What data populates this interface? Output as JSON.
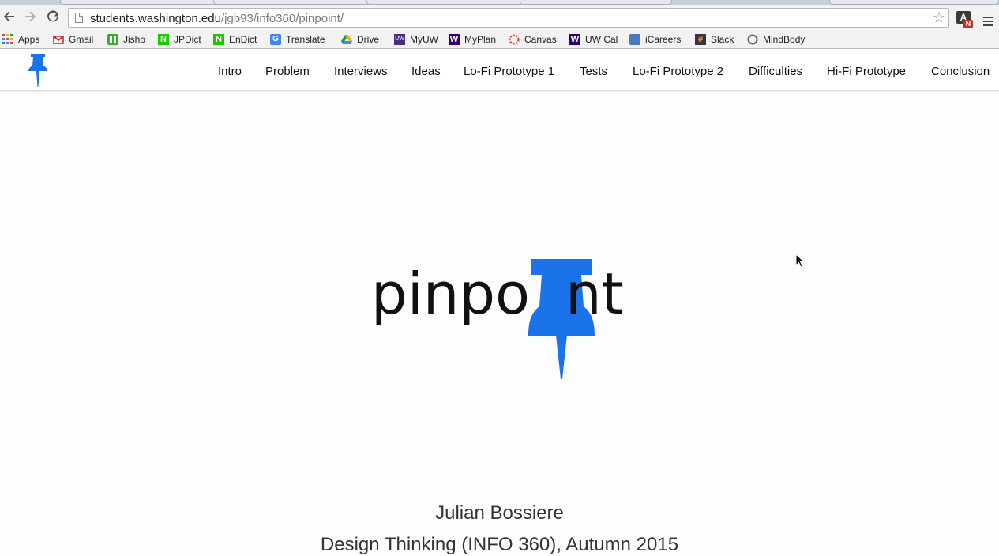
{
  "browser": {
    "url_host": "students.washington.edu",
    "url_path": "/jgb93/info360/pinpoint/",
    "bookmarks": [
      {
        "label": "Apps",
        "icon": "apps-grid-icon"
      },
      {
        "label": "Gmail",
        "icon": "gmail-icon"
      },
      {
        "label": "Jisho",
        "icon": "jisho-icon"
      },
      {
        "label": "JPDict",
        "icon": "jpdict-icon"
      },
      {
        "label": "EnDict",
        "icon": "endict-icon"
      },
      {
        "label": "Translate",
        "icon": "translate-icon"
      },
      {
        "label": "Drive",
        "icon": "drive-icon"
      },
      {
        "label": "MyUW",
        "icon": "myuw-icon"
      },
      {
        "label": "MyPlan",
        "icon": "myplan-icon"
      },
      {
        "label": "Canvas",
        "icon": "canvas-icon"
      },
      {
        "label": "UW Cal",
        "icon": "uwcal-icon"
      },
      {
        "label": "iCareers",
        "icon": "icareers-icon"
      },
      {
        "label": "Slack",
        "icon": "slack-icon"
      },
      {
        "label": "MindBody",
        "icon": "mindbody-icon"
      }
    ],
    "extension_badge": {
      "letter": "A",
      "sub": "N"
    }
  },
  "site_nav": {
    "items": [
      "Intro",
      "Problem",
      "Interviews",
      "Ideas",
      "Lo-Fi Prototype 1",
      "Tests",
      "Lo-Fi Prototype 2",
      "Difficulties",
      "Hi-Fi Prototype",
      "Conclusion"
    ]
  },
  "hero": {
    "logo_left": "pinpo",
    "logo_right": "nt"
  },
  "author": "Julian Bossiere",
  "course": "Design Thinking (INFO 360), Autumn 2015",
  "colors": {
    "brand_blue": "#1a73e8",
    "text": "#111111"
  }
}
